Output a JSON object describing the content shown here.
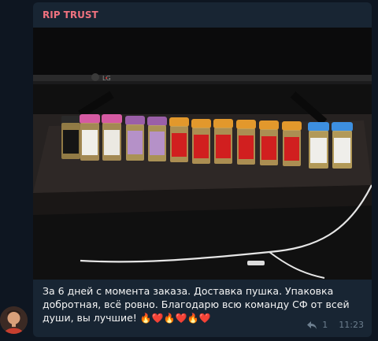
{
  "message": {
    "sender": "RIP TRUST",
    "caption_text": "За 6 дней с момента заказа. Доставка пушка. Упаковка добротная, всё ровно. Благодарю всю команду СФ от всей души, вы лучшие!",
    "emojis": [
      "🔥",
      "❤️",
      "🔥",
      "❤️",
      "🔥",
      "❤️"
    ],
    "reply_count": "1",
    "time": "11:23",
    "tv_brand": "LG"
  },
  "colors": {
    "background": "#0e1621",
    "bubble": "#182533",
    "sender_name": "#f0727f",
    "caption": "#f5f5f5",
    "meta": "#6d7f8f"
  },
  "icons": {
    "reply": "reply-arrow-icon",
    "avatar": "user-avatar-icon"
  }
}
